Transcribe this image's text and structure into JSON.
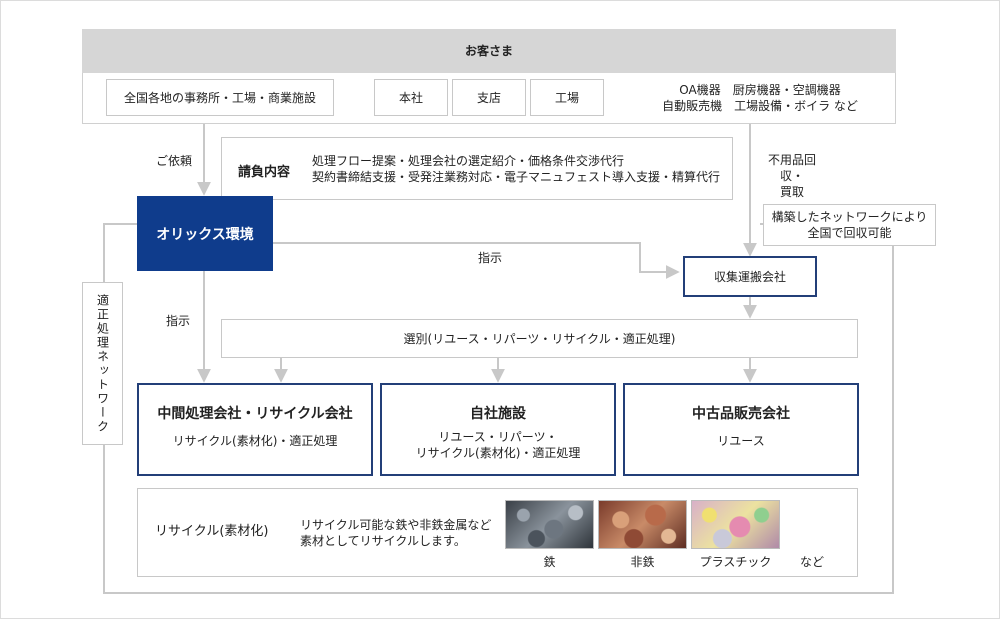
{
  "customer": {
    "title": "お客さま",
    "offices": "全国各地の事務所・工場・商業施設",
    "hq": "本社",
    "branch": "支店",
    "factory": "工場",
    "equipment_line1": "OA機器　厨房機器・空調機器",
    "equipment_line2": "自動販売機　工場設備・ボイラ など"
  },
  "labels": {
    "request": "ご依頼",
    "instruct_left": "指示",
    "instruct_top": "指示",
    "buyback_line1": "不用品回収・",
    "buyback_line2": "買取",
    "network_vertical": "適正処理ネットワーク"
  },
  "contract": {
    "title": "請負内容",
    "line1": "処理フロー提案・処理会社の選定紹介・価格条件交渉代行",
    "line2": "契約書締結支援・受発注業務対応・電子マニュフェスト導入支援・精算代行"
  },
  "orix": "オリックス環境",
  "network_note": {
    "line1": "構築したネットワークにより",
    "line2": "全国で回収可能"
  },
  "collector": "収集運搬会社",
  "sorting": "選別(リユース・リパーツ・リサイクル・適正処理)",
  "boxes": [
    {
      "title": "中間処理会社・リサイクル会社",
      "line1": "リサイクル(素材化)・適正処理",
      "line2": ""
    },
    {
      "title": "自社施設",
      "line1": "リユース・リパーツ・",
      "line2": "リサイクル(素材化)・適正処理"
    },
    {
      "title": "中古品販売会社",
      "line1": "リユース",
      "line2": ""
    }
  ],
  "recycle": {
    "title": "リサイクル(素材化)",
    "desc_line1": "リサイクル可能な鉄や非鉄金属など",
    "desc_line2": "素材としてリサイクルします。",
    "photos": [
      "鉄",
      "非鉄",
      "プラスチック"
    ],
    "etc": "など"
  },
  "colors": {
    "navy": "#0f3c8c",
    "gray_header": "#d6d6d6",
    "line": "#c8c8c8"
  }
}
